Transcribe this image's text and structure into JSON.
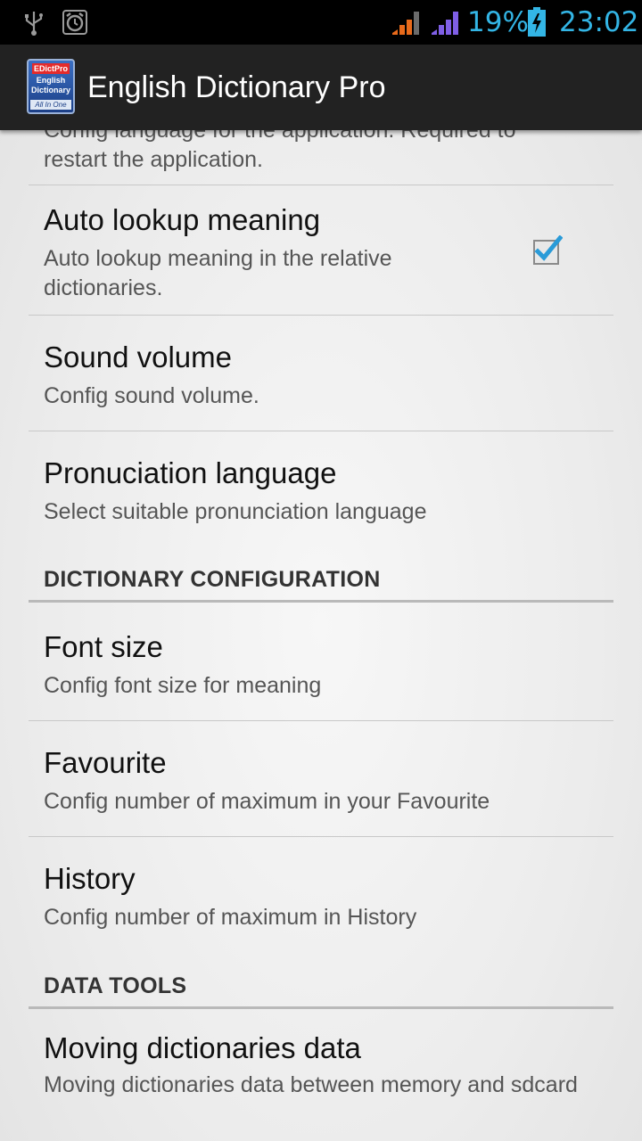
{
  "status_bar": {
    "icons": [
      "usb-icon",
      "alarm-icon",
      "signal-icon",
      "signal-icon",
      "battery-charging-icon"
    ],
    "battery_percent": "19%",
    "time": "23:02",
    "accent_color": "#33b5e5"
  },
  "action_bar": {
    "app_icon": {
      "tag": "EDictPro",
      "line1": "English",
      "line2": "Dictionary",
      "footer": "All In One"
    },
    "title": "English Dictionary Pro"
  },
  "preferences": {
    "partial_summary": "Config language for the application. Required to restart the application.",
    "auto_lookup": {
      "title": "Auto lookup meaning",
      "summary": "Auto lookup meaning in the relative dictionaries.",
      "checked": true
    },
    "sound_volume": {
      "title": "Sound volume",
      "summary": "Config sound volume."
    },
    "pronunciation": {
      "title": "Pronuciation language",
      "summary": "Select suitable pronunciation language"
    },
    "section_dictionary": "DICTIONARY CONFIGURATION",
    "font_size": {
      "title": "Font size",
      "summary": "Config font size for meaning"
    },
    "favourite": {
      "title": "Favourite",
      "summary": "Config number of maximum in your Favourite"
    },
    "history": {
      "title": "History",
      "summary": "Config number of maximum in History"
    },
    "section_data_tools": "DATA TOOLS",
    "moving_data": {
      "title": "Moving dictionaries data",
      "summary": "Moving dictionaries data between memory and sdcard"
    }
  }
}
